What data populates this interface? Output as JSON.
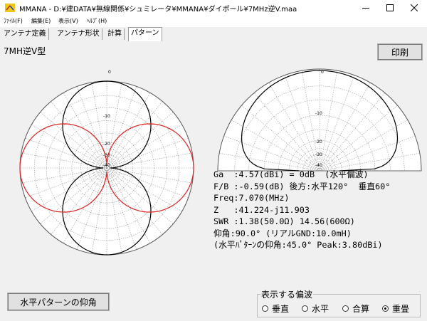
{
  "window": {
    "title": "MMANA - D:¥建DATA¥無線関係¥シュミレータ¥MMANA¥ダイポール¥7MHz逆V.maa"
  },
  "menu": [
    {
      "label": "ﾌｧｲﾙ(F)"
    },
    {
      "label": "編集(E)"
    },
    {
      "label": "表示(V)"
    },
    {
      "label": "ﾍﾙﾌﾟ(H)"
    }
  ],
  "tabs": [
    {
      "label": "アンテナ定義"
    },
    {
      "label": "アンテナ形状"
    },
    {
      "label": "計算"
    },
    {
      "label": "パターン",
      "active": true
    }
  ],
  "model_name": "7MH逆V型",
  "print_button": "印刷",
  "horizontal_plot": {
    "ring_labels": [
      "0",
      "-10",
      "-20",
      "-30",
      "-40"
    ],
    "colors": {
      "horizontal_pol": "#e02020",
      "vertical_pol": "#000000",
      "grid": "#9a9a9a"
    }
  },
  "vertical_plot": {
    "ring_labels": [
      "0",
      "-10",
      "-20",
      "-30",
      "-40"
    ]
  },
  "results": {
    "ga": "Ga  :4.57(dBi) = 0dB  (水平偏波)",
    "fb": "F/B :-0.59(dB) 後方:水平120°  垂直60°",
    "freq": "Freq:7.070(MHz)",
    "z": "Z   :41.224-j11.903",
    "swr": "SWR :1.38(50.0Ω) 14.56(600Ω)",
    "elev": "仰角:90.0° (リアルGND:10.0mH)",
    "hpattern": "(水平ﾊﾟﾀｰﾝの仰角:45.0° Peak:3.80dBi)"
  },
  "hpattern_button": "水平パターンの仰角",
  "polarization": {
    "title": "表示する偏波",
    "options": [
      {
        "label": "垂直",
        "selected": false
      },
      {
        "label": "水平",
        "selected": false
      },
      {
        "label": "合算",
        "selected": false
      },
      {
        "label": "重畳",
        "selected": true
      }
    ]
  }
}
